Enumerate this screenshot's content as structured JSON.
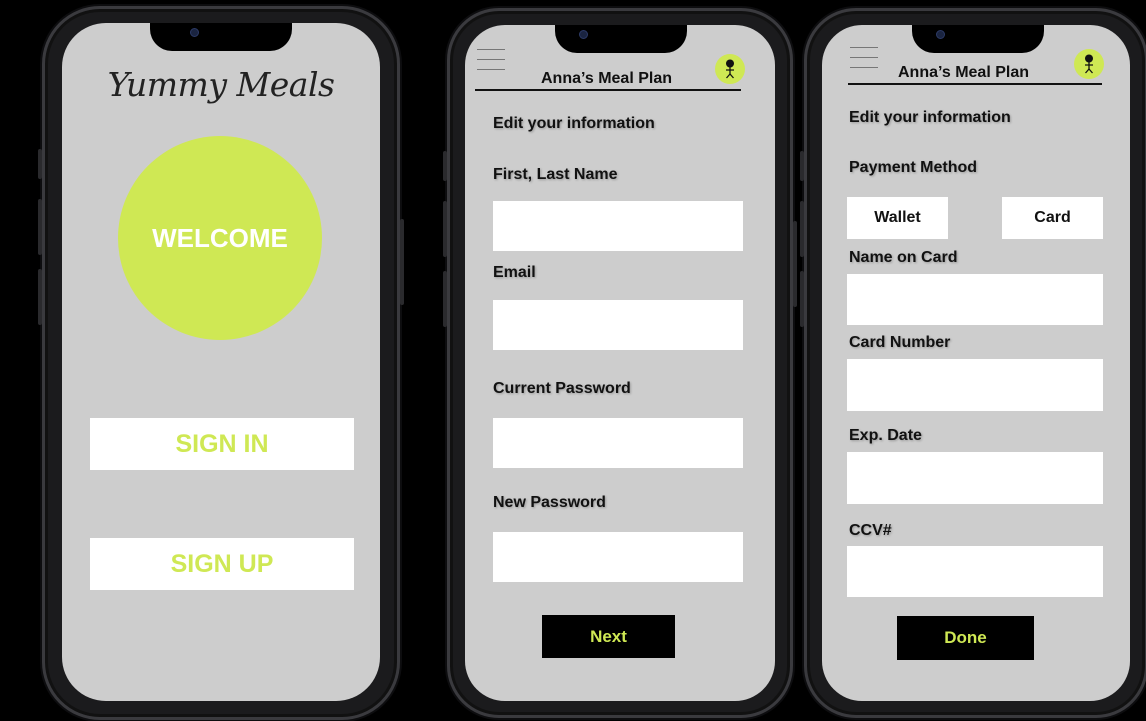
{
  "screen1": {
    "logo": "Yummy Meals",
    "welcome": "WELCOME",
    "sign_in": "SIGN IN",
    "sign_up": "SIGN UP"
  },
  "screen2": {
    "header_title": "Anna’s Meal Plan",
    "section_title": "Edit your information",
    "labels": {
      "name": "First, Last Name",
      "email": "Email",
      "current_password": "Current Password",
      "new_password": "New Password"
    },
    "next": "Next"
  },
  "screen3": {
    "header_title": "Anna’s Meal Plan",
    "section_title": "Edit your information",
    "payment_method": "Payment Method",
    "wallet": "Wallet",
    "card": "Card",
    "labels": {
      "name_on_card": "Name on Card",
      "card_number": "Card Number",
      "exp_date": "Exp. Date",
      "ccv": "CCV#"
    },
    "done": "Done"
  },
  "icons": {
    "menu": "hamburger-menu-icon",
    "avatar": "stick-figure-avatar-icon"
  },
  "colors": {
    "accent": "#cfe854",
    "screen_bg": "#cdcdcd",
    "button_dark": "#000000"
  }
}
